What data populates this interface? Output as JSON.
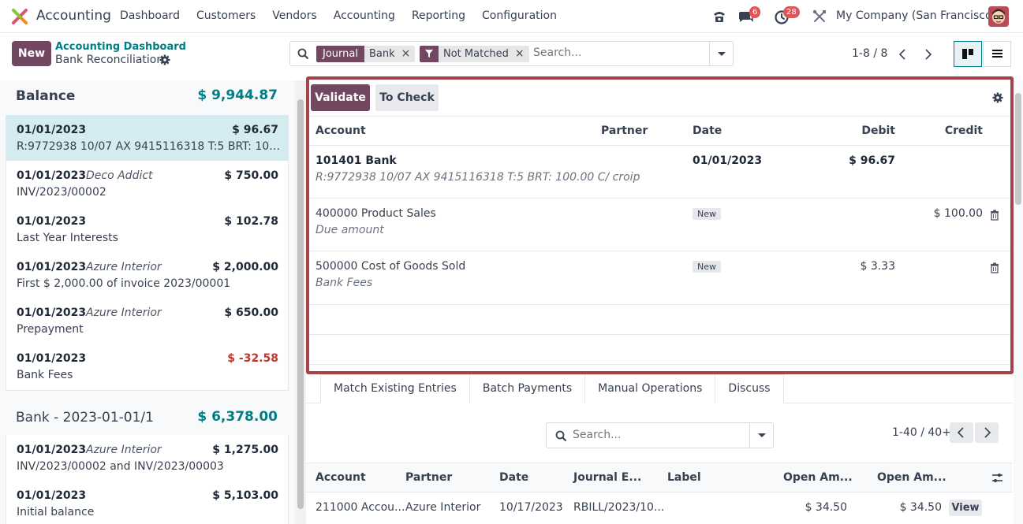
{
  "navbar": {
    "app_name": "Accounting",
    "menu": [
      "Dashboard",
      "Customers",
      "Vendors",
      "Accounting",
      "Reporting",
      "Configuration"
    ],
    "messages_badge": "6",
    "activities_badge": "28",
    "company": "My Company (San Francisco)"
  },
  "control": {
    "new_label": "New",
    "breadcrumb_parent": "Accounting Dashboard",
    "breadcrumb_current": "Bank Reconciliation",
    "facets": [
      {
        "key": "Journal",
        "value": "Bank"
      },
      {
        "key_icon": "filter-icon",
        "value": "Not Matched"
      }
    ],
    "search_placeholder": "Search...",
    "pager": "1-8 / 8"
  },
  "left": {
    "statements": [
      {
        "title": "Balance",
        "amount": "$ 9,944.87",
        "lines": [
          {
            "date": "01/01/2023",
            "partner": "",
            "amount": "$ 96.67",
            "label": "R:9772938 10/07 AX 9415116318 T:5 BRT: 100.00 C/ croip",
            "selected": true
          },
          {
            "date": "01/01/2023",
            "partner": "Deco Addict",
            "amount": "$ 750.00",
            "label": "INV/2023/00002"
          },
          {
            "date": "01/01/2023",
            "partner": "",
            "amount": "$ 102.78",
            "label": "Last Year Interests"
          },
          {
            "date": "01/01/2023",
            "partner": "Azure Interior",
            "amount": "$ 2,000.00",
            "label": "First $ 2,000.00 of invoice 2023/00001"
          },
          {
            "date": "01/01/2023",
            "partner": "Azure Interior",
            "amount": "$ 650.00",
            "label": "Prepayment"
          },
          {
            "date": "01/01/2023",
            "partner": "",
            "amount": "$ -32.58",
            "label": "Bank Fees",
            "negative": true
          }
        ]
      },
      {
        "title": "Bank - 2023-01-01/1",
        "amount": "$ 6,378.00",
        "lines": [
          {
            "date": "01/01/2023",
            "partner": "Azure Interior",
            "amount": "$ 1,275.00",
            "label": "INV/2023/00002 and INV/2023/00003"
          },
          {
            "date": "01/01/2023",
            "partner": "",
            "amount": "$ 5,103.00",
            "label": "Initial balance"
          }
        ]
      }
    ]
  },
  "form": {
    "validate_label": "Validate",
    "to_check_label": "To Check",
    "columns": {
      "account": "Account",
      "partner": "Partner",
      "date": "Date",
      "debit": "Debit",
      "credit": "Credit"
    },
    "lines": [
      {
        "account": "101401 Bank",
        "sub": "R:9772938 10/07 AX 9415116318 T:5 BRT: 100.00 C/ croip",
        "date": "01/01/2023",
        "debit": "$ 96.67",
        "credit": ""
      },
      {
        "account": "400000 Product Sales",
        "sub": "Due amount",
        "tag": "New",
        "debit": "",
        "credit": "$ 100.00"
      },
      {
        "account": "500000 Cost of Goods Sold",
        "sub": "Bank Fees",
        "tag": "New",
        "debit": "$ 3.33",
        "credit": ""
      }
    ]
  },
  "tabs": [
    "Match Existing Entries",
    "Batch Payments",
    "Manual Operations",
    "Discuss"
  ],
  "match": {
    "search_placeholder": "Search...",
    "pager": "1-40 / 40+",
    "columns": [
      "Account",
      "Partner",
      "Date",
      "Journal E...",
      "Label",
      "Open Am...",
      "Open Am..."
    ],
    "rows": [
      {
        "account": "211000 Accou...",
        "partner": "Azure Interior",
        "date": "10/17/2023",
        "journal": "RBILL/2023/10...",
        "label": "",
        "open1": "$ 34.50",
        "open2": "$ 34.50",
        "view": "View"
      }
    ]
  },
  "colors": {
    "primary": "#71485f",
    "teal": "#017e84",
    "highlight": "#a3434a",
    "negative": "#c0392b"
  }
}
